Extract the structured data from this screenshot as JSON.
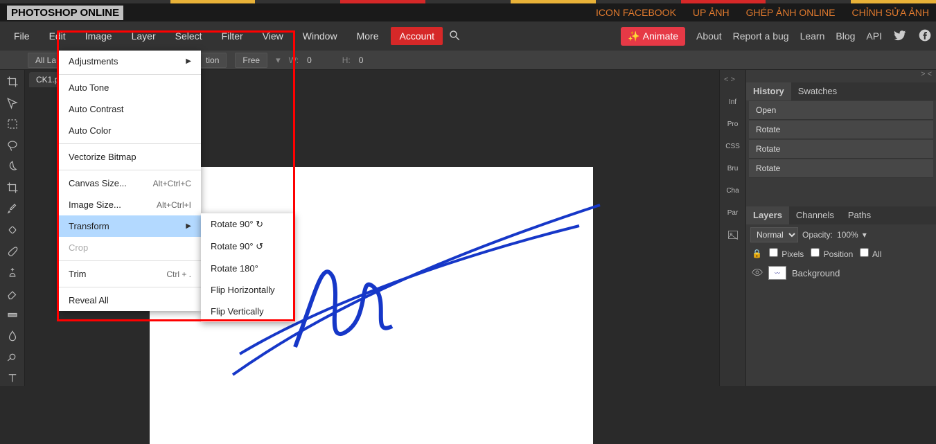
{
  "strip_colors": [
    "#333",
    "#333",
    "#e9b238",
    "#333",
    "#d62828",
    "#333",
    "#e9b238",
    "#333",
    "#d62828",
    "#333",
    "#e9b238"
  ],
  "header": {
    "site_title": "PHOTOSHOP ONLINE",
    "links": [
      "ICON FACEBOOK",
      "UP ẢNH",
      "GHÉP ẢNH ONLINE",
      "CHỈNH SỬA ẢNH"
    ]
  },
  "menubar": {
    "items": [
      "File",
      "Edit",
      "Image",
      "Layer",
      "Select",
      "Filter",
      "View",
      "Window",
      "More"
    ],
    "account": "Account",
    "animate": "Animate",
    "right": [
      "About",
      "Report a bug",
      "Learn",
      "Blog",
      "API"
    ]
  },
  "options": {
    "layers_dd": "All La",
    "tion": "tion",
    "free": "Free",
    "w_label": "W:",
    "w_val": "0",
    "h_label": "H:",
    "h_val": "0"
  },
  "tab": {
    "name": "CK1.p"
  },
  "dropdown": {
    "items": [
      {
        "label": "Adjustments",
        "arrow": true
      },
      {
        "sep": true
      },
      {
        "label": "Auto Tone"
      },
      {
        "label": "Auto Contrast"
      },
      {
        "label": "Auto Color"
      },
      {
        "sep": true
      },
      {
        "label": "Vectorize Bitmap"
      },
      {
        "sep": true
      },
      {
        "label": "Canvas Size...",
        "shortcut": "Alt+Ctrl+C"
      },
      {
        "label": "Image Size...",
        "shortcut": "Alt+Ctrl+I"
      },
      {
        "label": "Transform",
        "arrow": true,
        "hl": true
      },
      {
        "label": "Crop",
        "disabled": true
      },
      {
        "sep": true
      },
      {
        "label": "Trim",
        "shortcut": "Ctrl + ."
      },
      {
        "sep": true
      },
      {
        "label": "Reveal All"
      }
    ]
  },
  "submenu": {
    "items": [
      "Rotate 90° ↻",
      "Rotate 90° ↺",
      "Rotate 180°",
      "Flip Horizontally",
      "Flip Vertically"
    ]
  },
  "rail": {
    "nav_left": "< >",
    "nav_right": "> <",
    "items": [
      "Inf",
      "Pro",
      "CSS",
      "Bru",
      "Cha",
      "Par"
    ]
  },
  "history": {
    "tabs": [
      "History",
      "Swatches"
    ],
    "items": [
      "Open",
      "Rotate",
      "Rotate",
      "Rotate"
    ]
  },
  "layers": {
    "tabs": [
      "Layers",
      "Channels",
      "Paths"
    ],
    "blend": "Normal",
    "opacity_label": "Opacity:",
    "opacity_val": "100%",
    "lock_label": "🔒",
    "pixels": "Pixels",
    "position": "Position",
    "all": "All",
    "layer_name": "Background"
  }
}
